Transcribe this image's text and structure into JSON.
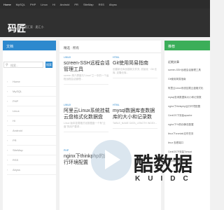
{
  "nav": {
    "items": [
      "Home",
      "MySQL",
      "PHP",
      "Linux",
      "Hi",
      "Android",
      "PR",
      "SiteMap",
      "RSS",
      "Abyss"
    ]
  },
  "header": {
    "logo": "码匠",
    "tagline": "麦汇家 · 麦汇小"
  },
  "left_sidebar": {
    "title": "文档",
    "search_placeholder": "搜索...",
    "search_button": "搜索",
    "categories": [
      "Home",
      "MySQL",
      "PHP",
      "Linux",
      "Hi",
      "Android",
      "PR",
      "SiteMap",
      "RSS",
      "Abyss"
    ]
  },
  "main": {
    "heading": "精选 · 所有",
    "posts": [
      {
        "tag": "LINUX",
        "title": "screen-SSH远程会话管理工具",
        "excerpt": "screen 简介屏幕与\"Linux\"之一中的一个运程远程会话管理..."
      },
      {
        "tag": "HTML",
        "title": "Git使用简易指南",
        "excerpt": "创建新仓库创建新文件夹, 初始化 · Git 仓库, 克隆仓库..."
      },
      {
        "tag": "LINUX",
        "title": "阿里云Linux系统挂载云盘格式化数据盘",
        "excerpt": "Linux 版本挂载格式化数据盘一个有\"云盘\"的用户要求..."
      },
      {
        "tag": "HTML",
        "title": "mysql数据库查数据库的大小和记录数",
        "excerpt": "TABLE_NAME DATA_LENGTH INDEX..."
      },
      {
        "tag": "PHP",
        "title": "nginx下thinkphp的运行环境配置",
        "excerpt": ""
      }
    ]
  },
  "right_sidebar": {
    "title": "推荐",
    "subtitle": "近期文章",
    "items": [
      "screen-SSH远程会话管理工具",
      "Git使用简易指南",
      "阿里云Linux系统挂载云盘格式化",
      "mysql查询数据库大小和记录数",
      "nginx下thinkphp运行环境配置",
      "CentOS下安装apache",
      "nginx下Yii的伪静态配置",
      "linux下crontab定时任务",
      "linux 查看端口",
      "CentOS下安装Tomcat",
      "ubuntu常用命令"
    ]
  },
  "watermark": {
    "text": "酷数据",
    "subtext": "KUIDC"
  },
  "colors": {
    "primary": "#2d89ce",
    "accent": "#3bae59",
    "header": "#303030"
  }
}
